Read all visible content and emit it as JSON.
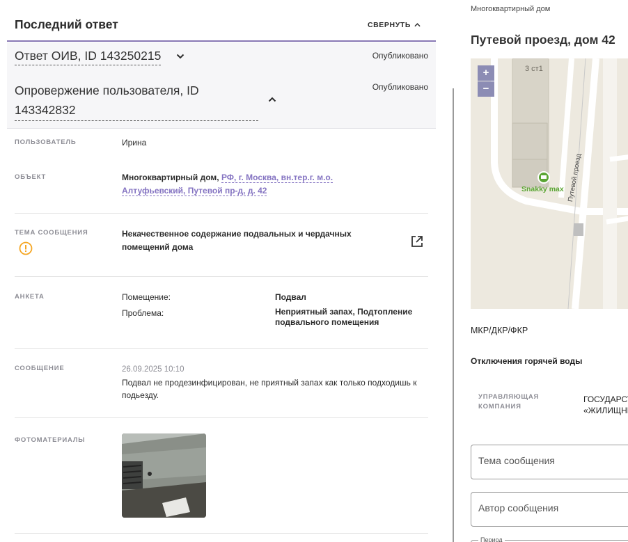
{
  "header": {
    "title": "Последний ответ",
    "collapse_label": "СВЕРНУТЬ"
  },
  "oiv": {
    "title": "Ответ ОИВ, ID 143250215",
    "status": "Опубликовано"
  },
  "refutation": {
    "title": "Опровержение пользователя, ID 143342832",
    "status": "Опубликовано"
  },
  "details": {
    "user": {
      "label": "ПОЛЬЗОВАТЕЛЬ",
      "value": "Ирина"
    },
    "object": {
      "label": "ОБЪЕКТ",
      "type": "Многоквартирный дом,",
      "address": "РФ, г. Москва, вн.тер.г. м.о. Алтуфьевский, Путевой пр-д, д. 42"
    },
    "topic": {
      "label": "ТЕМА СООБЩЕНИЯ",
      "value": "Некачественное содержание подвальных и чердачных помещений дома"
    },
    "survey": {
      "label": "АНКЕТА",
      "rows": [
        {
          "q": "Помещение:",
          "a": "Подвал"
        },
        {
          "q": "Проблема:",
          "a": "Неприятный запах, Подтопление подвального помещения"
        }
      ]
    },
    "message": {
      "label": "СООБЩЕНИЕ",
      "timestamp": "26.09.2025 10:10",
      "text": "Подвал не продезинфицирован, не приятный запах как только подходишь к подьезду."
    },
    "photos": {
      "label": "ФОТОМАТЕРИАЛЫ"
    }
  },
  "right": {
    "object_type": "Многоквартирный дом",
    "address": "Путевой проезд, дом 42",
    "map": {
      "zoom_in": "+",
      "zoom_out": "−",
      "building_label": "3 ст1",
      "poi_label": "Snakky max",
      "street_label": "Путевой проезд",
      "poi_color": "#5aa533"
    },
    "mkr": "МКР/ДКР/ФКР",
    "hot_water": "Отключения горячей воды",
    "management_label": "УПРАВЛЯЮЩАЯ КОМПАНИЯ",
    "management_value_line1": "ГОСУДАРСТВЕННОЕ",
    "management_value_line2": "«ЖИЛИЩНИК",
    "topic_placeholder": "Тема сообщения",
    "author_placeholder": "Автор сообщения",
    "period_label": "Период"
  },
  "colors": {
    "accent": "#8574c2",
    "header_underline": "#8878b4",
    "warning": "#f5a623",
    "zoom_button": "#8c8cb4"
  }
}
